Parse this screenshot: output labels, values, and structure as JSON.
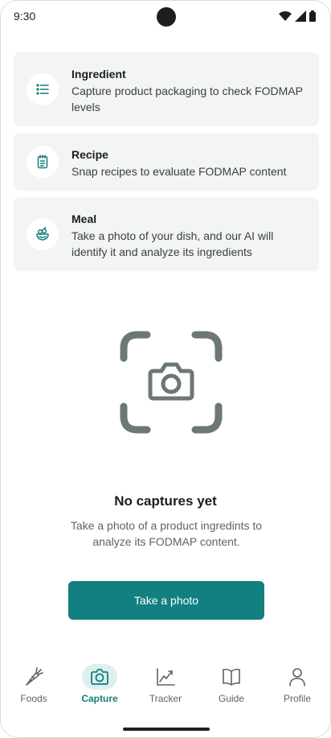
{
  "status_bar": {
    "time": "9:30",
    "icons": [
      "wifi-icon",
      "signal-icon",
      "battery-icon"
    ]
  },
  "options": [
    {
      "icon": "list-icon",
      "title": "Ingredient",
      "description": "Capture product packaging to check FODMAP levels"
    },
    {
      "icon": "recipe-icon",
      "title": "Recipe",
      "description": "Snap recipes to evaluate FODMAP content"
    },
    {
      "icon": "bowl-icon",
      "title": "Meal",
      "description": "Take a photo of your dish, and our AI will identify it and analyze its ingredients"
    }
  ],
  "empty_state": {
    "title": "No captures yet",
    "description": "Take a photo of a product ingredints to analyze its FODMAP content.",
    "button_label": "Take a photo"
  },
  "bottom_nav": {
    "items": [
      {
        "label": "Foods",
        "icon": "carrot-icon",
        "active": false
      },
      {
        "label": "Capture",
        "icon": "camera-icon",
        "active": true
      },
      {
        "label": "Tracker",
        "icon": "chart-icon",
        "active": false
      },
      {
        "label": "Guide",
        "icon": "book-icon",
        "active": false
      },
      {
        "label": "Profile",
        "icon": "person-icon",
        "active": false
      }
    ]
  },
  "colors": {
    "accent": "#127f80",
    "accent_light": "#dcf0ef",
    "card_background": "#f3f4f4",
    "viewfinder": "#6b7875"
  }
}
